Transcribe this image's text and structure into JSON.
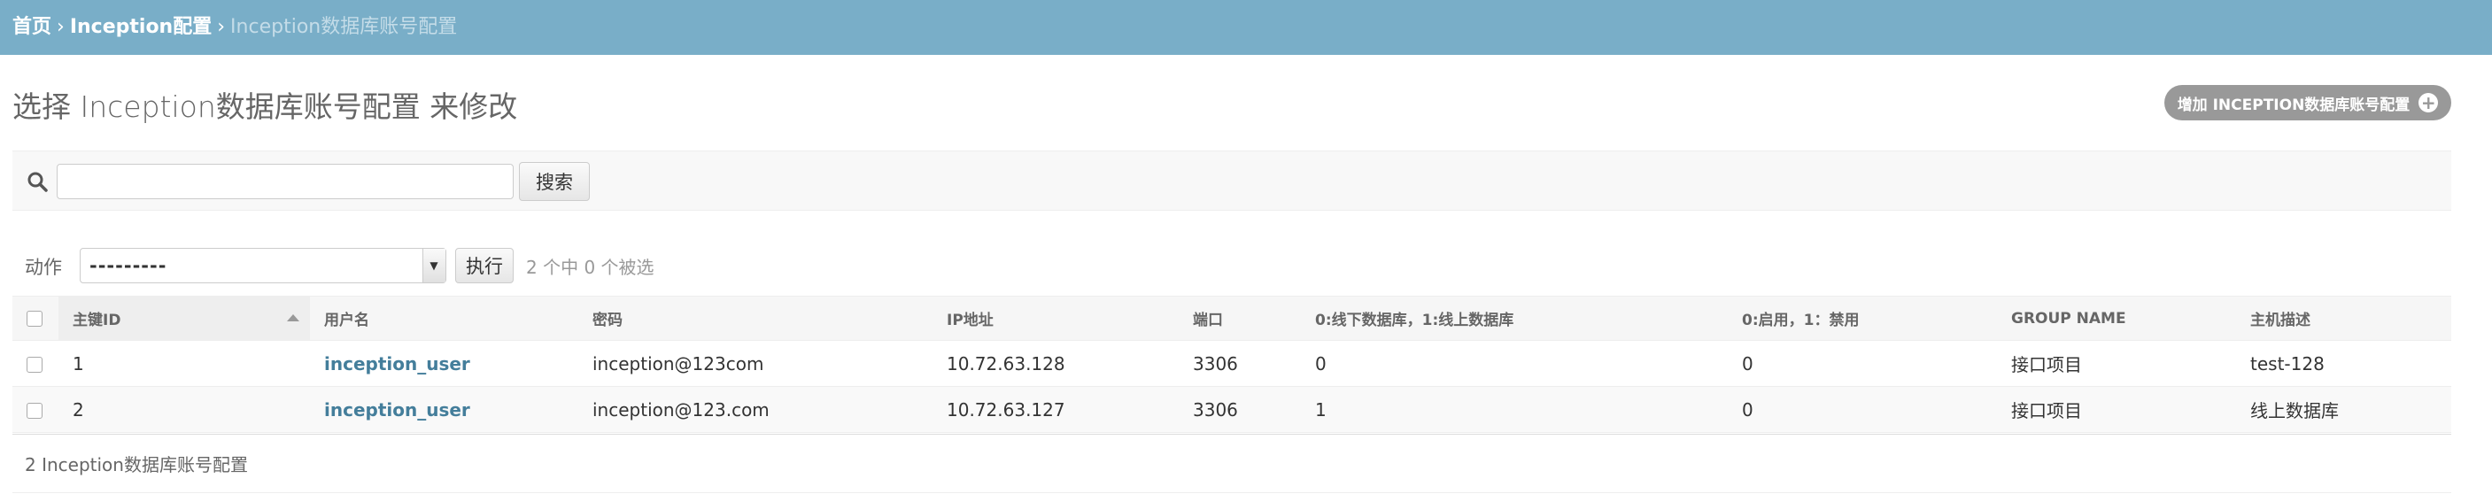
{
  "breadcrumbs": {
    "home": "首页",
    "sep1": "›",
    "app": "Inception配置",
    "sep2": "›",
    "current": "Inception数据库账号配置"
  },
  "title": "选择 Inception数据库账号配置 来修改",
  "add_button": {
    "label": "增加 INCEPTION数据库账号配置",
    "icon": "plus-icon"
  },
  "search": {
    "value": "",
    "placeholder": "",
    "button_label": "搜索",
    "icon": "search-icon"
  },
  "actions": {
    "label": "动作",
    "selected": "---------",
    "go_label": "执行",
    "counter": "2 个中 0 个被选"
  },
  "table": {
    "headers": [
      "主键ID",
      "用户名",
      "密码",
      "IP地址",
      "端口",
      "0:线下数据库，1:线上数据库",
      "0:启用，1：禁用",
      "GROUP NAME",
      "主机描述"
    ],
    "rows": [
      [
        "1",
        "inception_user",
        "inception@123com",
        "10.72.63.128",
        "3306",
        "0",
        "0",
        "接口项目",
        "test-128"
      ],
      [
        "2",
        "inception_user",
        "inception@123.com",
        "10.72.63.127",
        "3306",
        "1",
        "0",
        "接口项目",
        "线上数据库"
      ]
    ]
  },
  "paginator": "2 Inception数据库账号配置",
  "colors": {
    "header_bg": "#79aec8",
    "link": "#447e9b",
    "add_button_bg": "#999999"
  }
}
